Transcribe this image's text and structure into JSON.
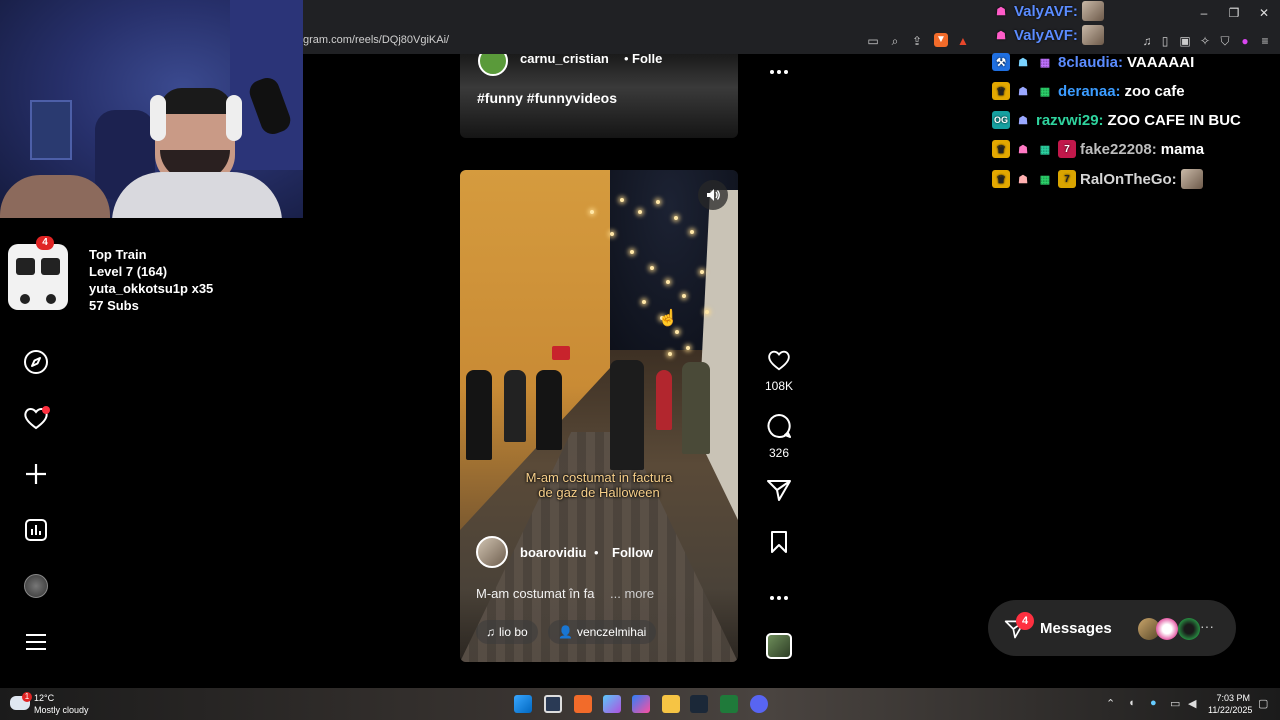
{
  "browser": {
    "url": "gram.com/reels/DQj80VgiKAi/",
    "toolbar_icons": [
      "picture-in-picture-icon",
      "zoom-icon",
      "share-icon",
      "brave-shield-icon",
      "brave-rewards-icon",
      "music-icon",
      "sidebar-icon",
      "wallet-icon",
      "extensions-icon",
      "vpn-icon",
      "leo-icon",
      "menu-icon"
    ],
    "window_controls": [
      "minimize-icon",
      "restore-icon",
      "close-icon"
    ]
  },
  "stream_widget": {
    "badge": "4",
    "lines": [
      "Top Train",
      "Level 7  (164)",
      "yuta_okkotsu1p x35",
      "57 Subs"
    ]
  },
  "ig_nav": [
    "compass-icon",
    "heart-icon",
    "plus-icon",
    "insights-icon",
    "profile-avatar",
    "menu-icon"
  ],
  "previous_reel": {
    "username": "carnu_cristian",
    "follow": "Folle",
    "caption": "#funny #funnyvideos"
  },
  "reel": {
    "overlay_line1": "M-am costumat in factura",
    "overlay_line2": "de gaz de Halloween",
    "username": "boarovidiu",
    "separator": "•",
    "follow": "Follow",
    "caption": "M-am costumat în fa",
    "more": "... more",
    "audio": "lio  bo",
    "tagged_user": "venczelmihai"
  },
  "actions": {
    "likes": "108K",
    "comments": "326"
  },
  "chat": [
    {
      "user": "ValyAVF:",
      "color": "#5b8cff",
      "text": ""
    },
    {
      "user": "ValyAVF:",
      "color": "#5b8cff",
      "text": ""
    },
    {
      "user": "8claudia:",
      "color": "#5b8cff",
      "text": "VAAAAAI"
    },
    {
      "user": "deranaa:",
      "color": "#3b9cff",
      "text": "zoo cafe"
    },
    {
      "user": "razvwi29:",
      "color": "#2fd39e",
      "text": "ZOO CAFE IN BUC"
    },
    {
      "user": "fake22208:",
      "color": "#bdbdbd",
      "text": "mama"
    },
    {
      "user": "RalOnTheGo:",
      "color": "#d5d5d5",
      "text": ""
    }
  ],
  "messages": {
    "label": "Messages",
    "badge": "4",
    "more": "···"
  },
  "taskbar": {
    "temp": "12°C",
    "weather": "Mostly cloudy",
    "weather_badge": "1",
    "time": "7:03 PM",
    "date": "11/22/2025"
  }
}
